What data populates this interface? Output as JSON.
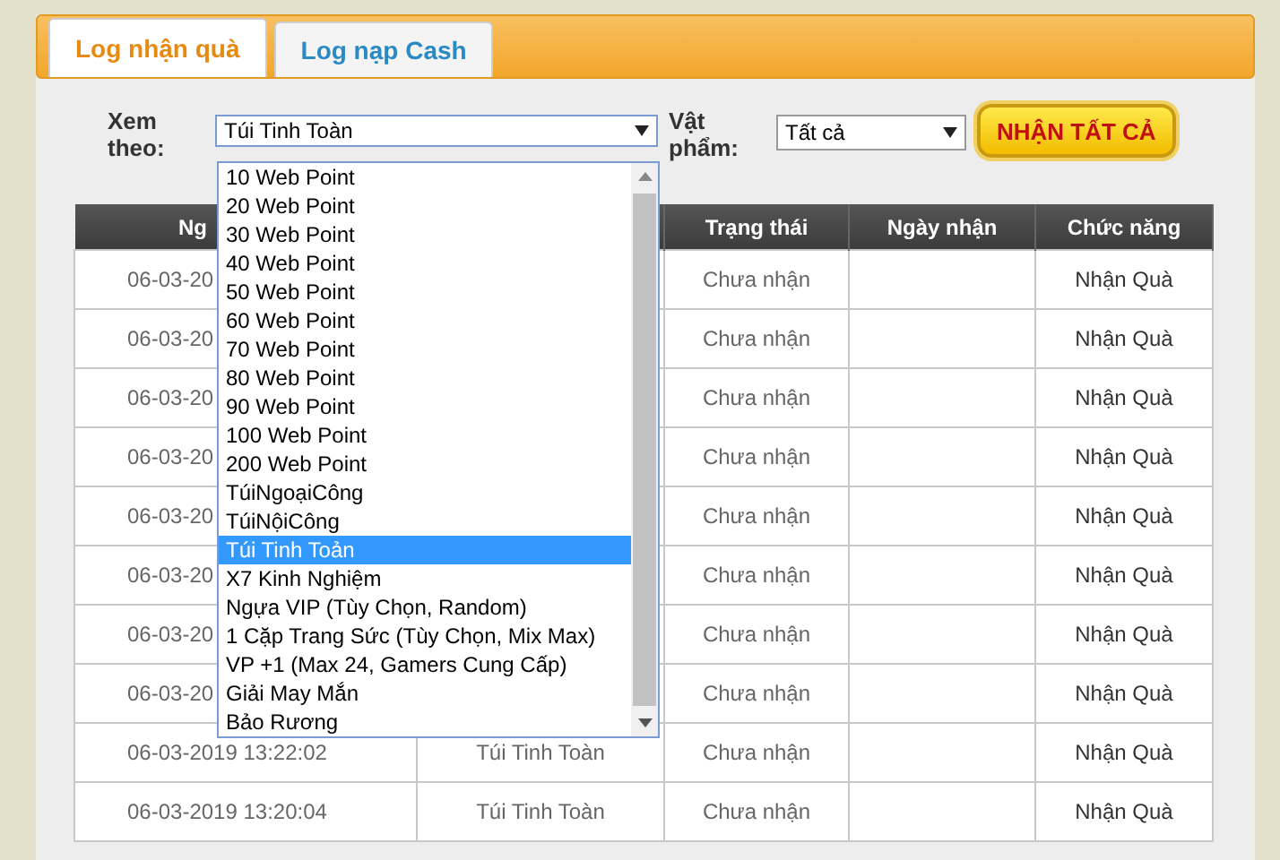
{
  "tabs": [
    {
      "label": "Log nhận quà",
      "selected": true
    },
    {
      "label": "Log nạp Cash",
      "selected": false
    }
  ],
  "filter": {
    "view_label": "Xem theo:",
    "view_value": "Túi Tinh Toàn",
    "item_label": "Vật phẩm:",
    "item_value": "Tất cả",
    "button": "NHẬN TẤT CẢ",
    "view_options": [
      {
        "label": "10 Web Point",
        "selected": false
      },
      {
        "label": "20 Web Point",
        "selected": false
      },
      {
        "label": "30 Web Point",
        "selected": false
      },
      {
        "label": "40 Web Point",
        "selected": false
      },
      {
        "label": "50 Web Point",
        "selected": false
      },
      {
        "label": "60 Web Point",
        "selected": false
      },
      {
        "label": "70 Web Point",
        "selected": false
      },
      {
        "label": "80 Web Point",
        "selected": false
      },
      {
        "label": "90 Web Point",
        "selected": false
      },
      {
        "label": "100 Web Point",
        "selected": false
      },
      {
        "label": "200 Web Point",
        "selected": false
      },
      {
        "label": "TúiNgoạiCông",
        "selected": false
      },
      {
        "label": "TúiNộiCông",
        "selected": false
      },
      {
        "label": "Túi Tinh Toản",
        "selected": true
      },
      {
        "label": "X7 Kinh Nghiệm",
        "selected": false
      },
      {
        "label": "Ngựa VIP (Tùy Chọn, Random)",
        "selected": false
      },
      {
        "label": "1 Cặp Trang Sức (Tùy Chọn, Mix Max)",
        "selected": false
      },
      {
        "label": "VP +1 (Max 24, Gamers Cung Cấp)",
        "selected": false
      },
      {
        "label": "Giải May Mắn",
        "selected": false
      },
      {
        "label": "Bảo Rương",
        "selected": false
      }
    ]
  },
  "table": {
    "columns": [
      "Ng",
      "Trạng thái",
      "Ngày nhận",
      "Chức năng"
    ],
    "rows": [
      {
        "date": "06-03-20",
        "status": "Chưa nhận",
        "action": "Nhận Quà"
      },
      {
        "date": "06-03-20",
        "status": "Chưa nhận",
        "action": "Nhận Quà"
      },
      {
        "date": "06-03-20",
        "status": "Chưa nhận",
        "action": "Nhận Quà"
      },
      {
        "date": "06-03-20",
        "status": "Chưa nhận",
        "action": "Nhận Quà"
      },
      {
        "date": "06-03-20",
        "status": "Chưa nhận",
        "action": "Nhận Quà"
      },
      {
        "date": "06-03-20",
        "status": "Chưa nhận",
        "action": "Nhận Quà"
      },
      {
        "date": "06-03-20",
        "status": "Chưa nhận",
        "action": "Nhận Quà"
      },
      {
        "date": "06-03-20",
        "status": "Chưa nhận",
        "action": "Nhận Quà"
      },
      {
        "date": "06-03-2019 13:22:02",
        "item": "Túi Tinh Toàn",
        "status": "Chưa nhận",
        "action": "Nhận Quà"
      },
      {
        "date": "06-03-2019 13:20:04",
        "item": "Túi Tinh Toàn",
        "status": "Chưa nhận",
        "action": "Nhận Quà"
      }
    ]
  }
}
